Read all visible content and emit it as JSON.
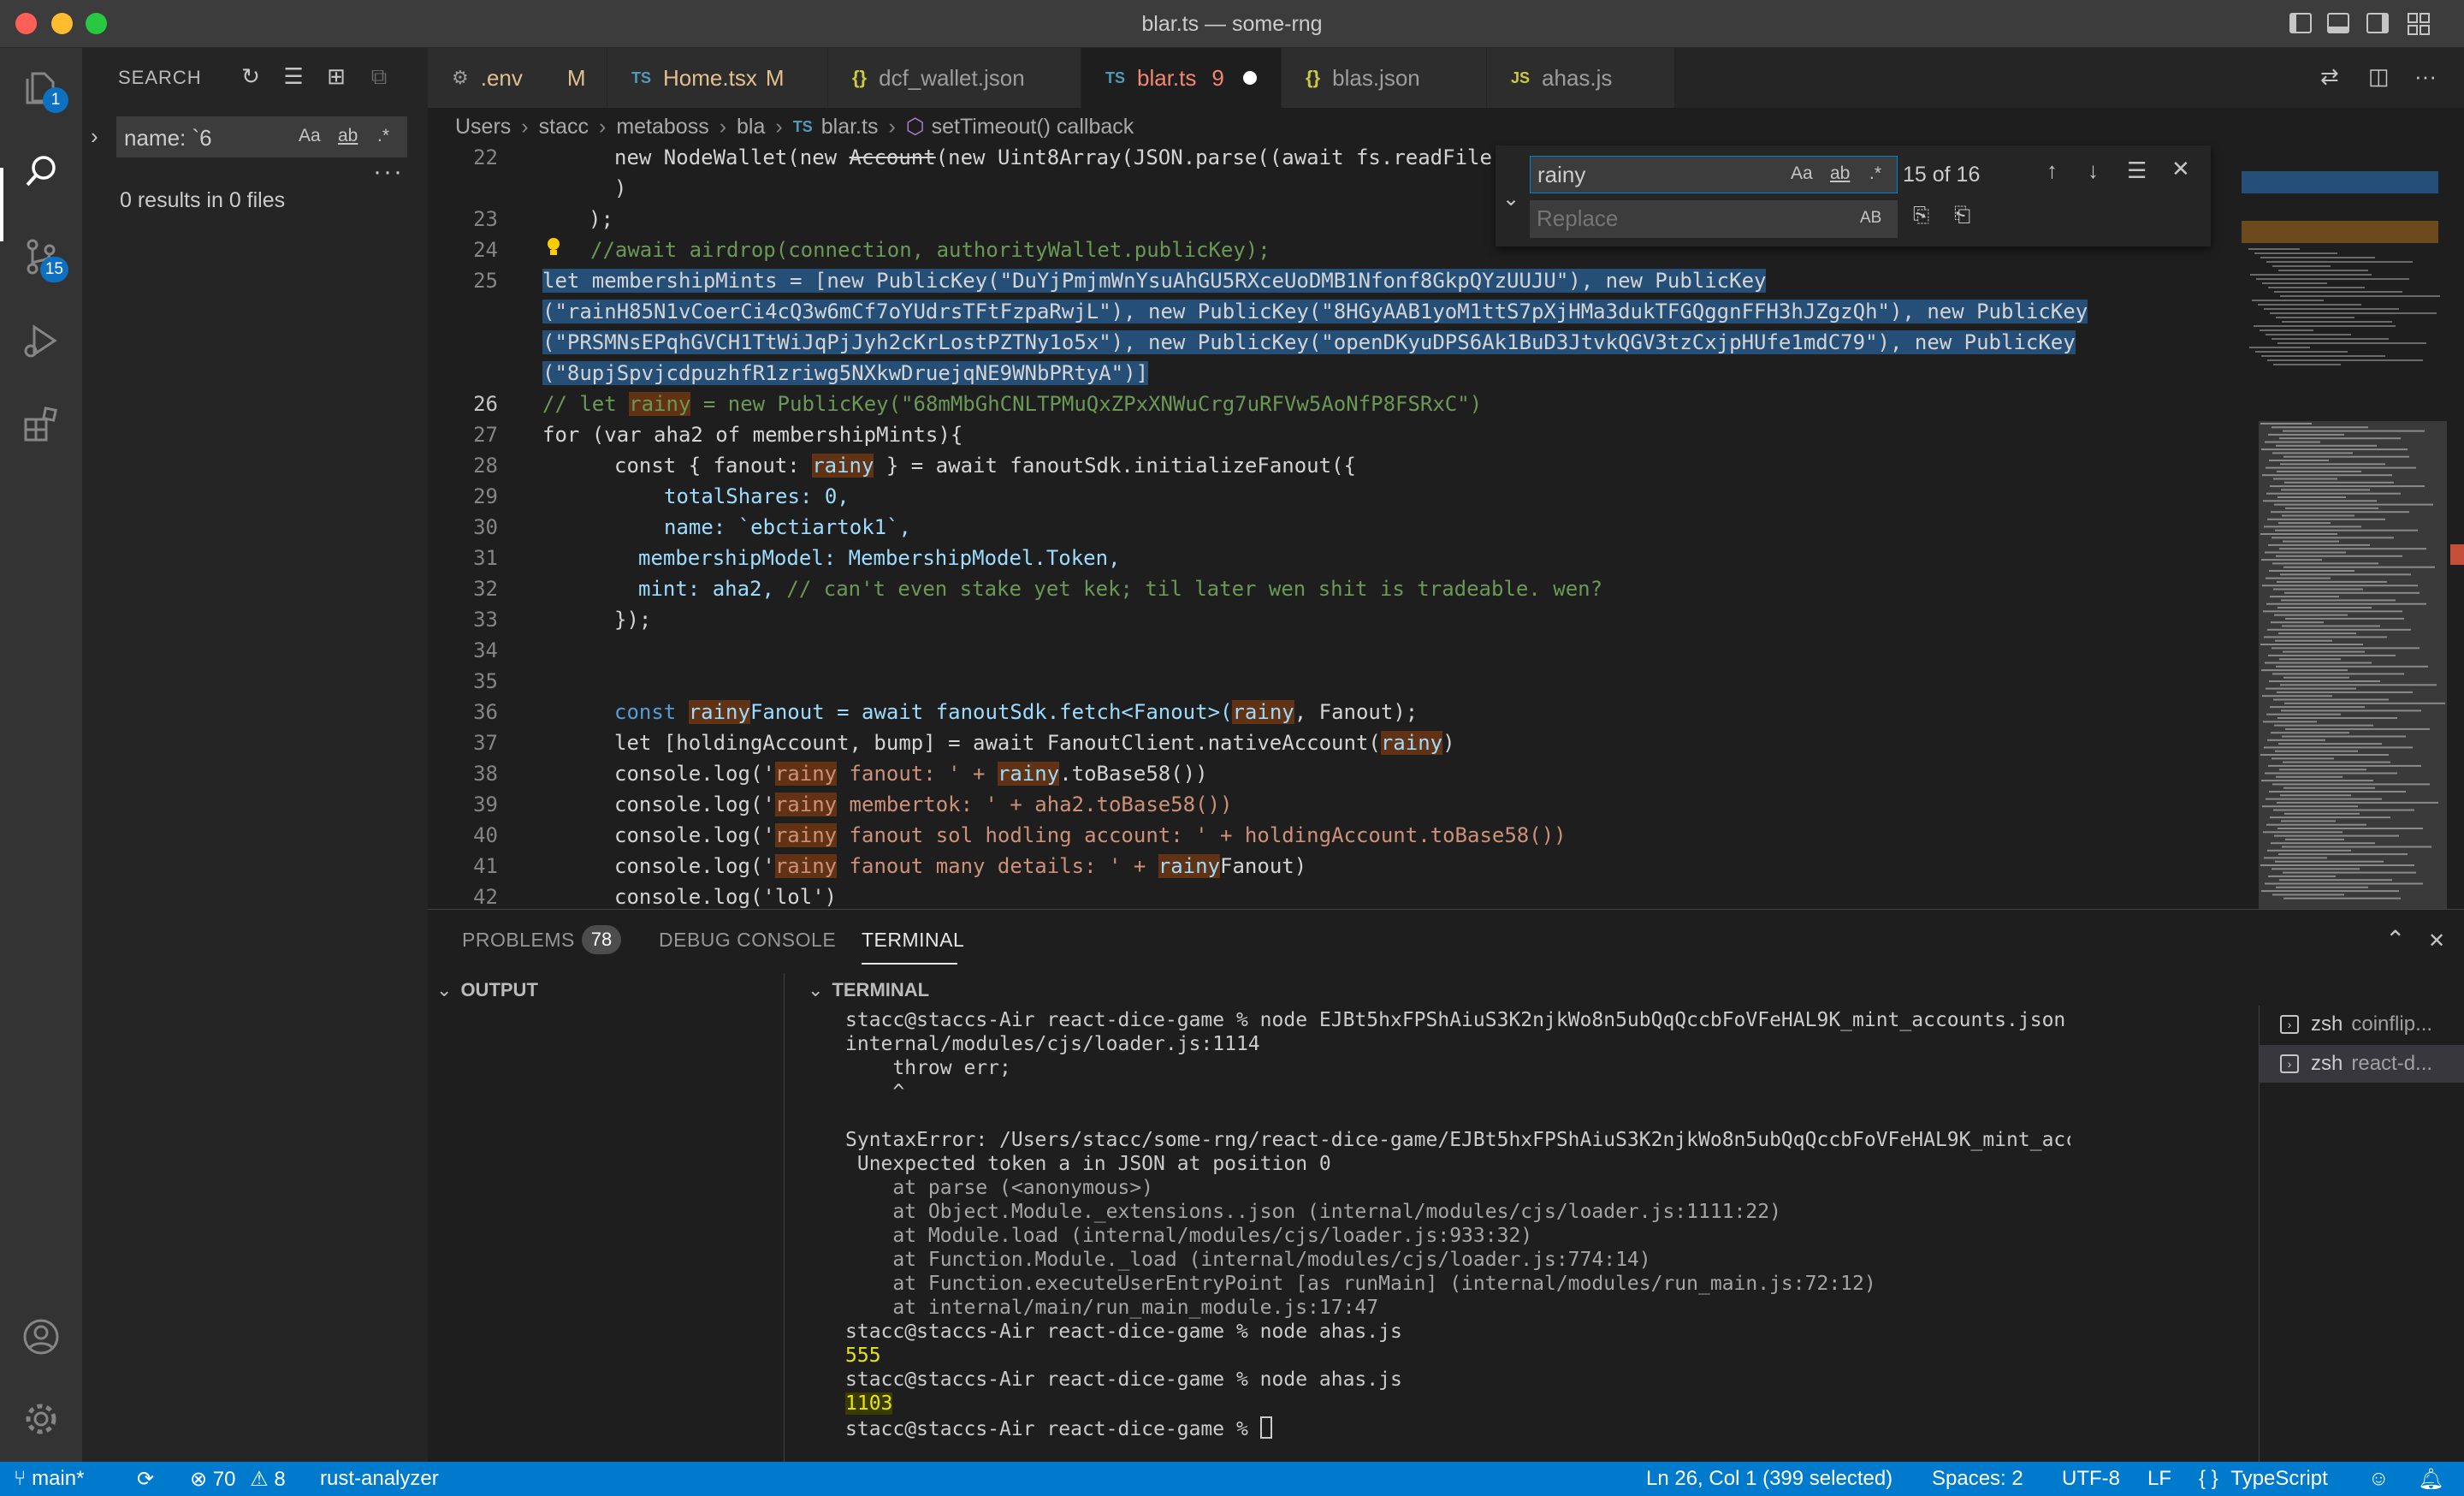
{
  "window": {
    "title": "blar.ts — some-rng"
  },
  "activity": {
    "explorer_badge": "1",
    "scm_badge": "15"
  },
  "sidebar": {
    "title": "SEARCH",
    "search_value": "name: `6",
    "opt_case": "Aa",
    "opt_word": "ab",
    "opt_regex": ".*",
    "results": "0 results in 0 files"
  },
  "tabs": [
    {
      "icon": "⚙",
      "label": ".env",
      "mod": "M"
    },
    {
      "icon": "TS",
      "label": "Home.tsx",
      "mod": "M"
    },
    {
      "icon": "{}",
      "label": "dcf_wallet.json",
      "mod": ""
    },
    {
      "icon": "TS",
      "label": "blar.ts",
      "mod": "9"
    },
    {
      "icon": "{}",
      "label": "blas.json",
      "mod": ""
    },
    {
      "icon": "JS",
      "label": "ahas.js",
      "mod": ""
    }
  ],
  "breadcrumb": [
    "Users",
    "stacc",
    "metaboss",
    "bla",
    "TS",
    "blar.ts",
    "setTimeout() callback"
  ],
  "editor": {
    "line_numbers": [
      "22",
      "",
      "23",
      "24",
      "25",
      "",
      "",
      "",
      "26",
      "27",
      "28",
      "29",
      "30",
      "31",
      "32",
      "33",
      "34",
      "35",
      "36",
      "37",
      "38",
      "39",
      "40",
      "41",
      "42"
    ],
    "l22a": "new NodeWallet(new ",
    "l22b": "Account",
    "l22c": "(new Uint8Array(JSON.parse((await fs.readFile",
    "l22d": ")",
    "l23": ");",
    "l24": "//await airdrop(connection, authorityWallet.publicKey);",
    "l25a": "let membershipMints = [new PublicKey(\"DuYjPmjmWnYsuAhGU5RXceUoDMB1Nfonf8GkpQYzUUJU\"), new PublicKey",
    "l25b": "(\"rainH85N1vCoerCi4cQ3w6mCf7oYUdrsTFtFzpaRwjL\"), new PublicKey(\"8HGyAAB1yoM1ttS7pXjHMa3dukTFGQggnFFH3hJZgzQh\"), new PublicKey",
    "l25c": "(\"PRSMNsEPqhGVCH1TtWiJqPjJyh2cKrLostPZTNy1o5x\"), new PublicKey(\"openDKyuDPS6Ak1BuD3JtvkQGV3tzCxjpHUfe1mdC79\"), new PublicKey",
    "l25d": "(\"8upjSpvjcdpuzhfR1zriwg5NXkwDruejqNE9WNbPRtyA\")]",
    "l26a": "// let ",
    "l26b": "rainy",
    "l26c": " = new PublicKey(\"68mMbGhCNLTPMuQxZPxXNWuCrg7uRFVw5AoNfP8FSRxC\")",
    "l27": "for (var aha2 of membershipMints){",
    "l28a": "const { fanout: ",
    "l28b": "rainy",
    "l28c": " } = await fanoutSdk.initializeFanout({",
    "l29": "totalShares: 0,",
    "l30": "name: `ebctiartok1`,",
    "l31": "membershipModel: MembershipModel.Token,",
    "l32a": "mint: aha2, ",
    "l32b": "// can't even stake yet kek; til later wen shit is tradeable. wen?",
    "l33": "});",
    "l36a": "const ",
    "l36b": "rainy",
    "l36c": "Fanout = await fanoutSdk.fetch<Fanout>(",
    "l36d": "rainy",
    "l36e": ", Fanout);",
    "l37a": "let [holdingAccount, bump] = await FanoutClient.nativeAccount(",
    "l37b": "rainy",
    "l37c": ")",
    "l38a": "console.log('",
    "l38b": "rainy",
    "l38c": " fanout: ' + ",
    "l38d": "rainy",
    "l38e": ".toBase58())",
    "l39a": "console.log('",
    "l39b": "rainy",
    "l39c": " membertok: ' + aha2.toBase58())",
    "l40a": "console.log('",
    "l40b": "rainy",
    "l40c": " fanout sol hodling account: ' + holdingAccount.toBase58())",
    "l41a": "console.log('",
    "l41b": "rainy",
    "l41c": " fanout many details: ' + ",
    "l41d": "rainy",
    "l41e": "Fanout)",
    "l42": "console.log('lol')"
  },
  "find": {
    "value": "rainy",
    "replace_placeholder": "Replace",
    "count": "15 of 16",
    "opt_case": "Aa",
    "opt_word": "ab",
    "opt_regex": ".*",
    "preserve_case": "AB"
  },
  "panel": {
    "tabs": [
      "PROBLEMS",
      "DEBUG CONSOLE",
      "TERMINAL"
    ],
    "problems_count": "78",
    "output_label": "OUTPUT",
    "terminal_label": "TERMINAL",
    "terminal_lines": [
      "stacc@staccs-Air react-dice-game % node EJBt5hxFPShAiuS3K2njkWo8n5ubQqQccbFoVFeHAL9K_mint_accounts.json",
      "internal/modules/cjs/loader.js:1114",
      "    throw err;",
      "    ^",
      "",
      "SyntaxError: /Users/stacc/some-rng/react-dice-game/EJBt5hxFPShAiuS3K2njkWo8n5ubQqQccbFoVFeHAL9K_mint_accounts.json:",
      " Unexpected token a in JSON at position 0",
      "    at parse (<anonymous>)",
      "    at Object.Module._extensions..json (internal/modules/cjs/loader.js:1111:22)",
      "    at Module.load (internal/modules/cjs/loader.js:933:32)",
      "    at Function.Module._load (internal/modules/cjs/loader.js:774:14)",
      "    at Function.executeUserEntryPoint [as runMain] (internal/modules/run_main.js:72:12)",
      "    at internal/main/run_main_module.js:17:47",
      "stacc@staccs-Air react-dice-game % node ahas.js",
      "555",
      "stacc@staccs-Air react-dice-game % node ahas.js",
      "1103",
      "stacc@staccs-Air react-dice-game % "
    ],
    "terminals": [
      {
        "name": "zsh",
        "sub": "coinflip..."
      },
      {
        "name": "zsh",
        "sub": "react-d..."
      }
    ]
  },
  "status": {
    "branch": "main*",
    "errors": "70",
    "warnings": "8",
    "analyzer": "rust-analyzer",
    "position": "Ln 26, Col 1 (399 selected)",
    "spaces": "Spaces: 2",
    "encoding": "UTF-8",
    "eol": "LF",
    "language": "TypeScript",
    "language_icon": "{ }"
  },
  "colors": {
    "accent": "#007acc",
    "selection": "#264f78",
    "match": "#613214"
  }
}
